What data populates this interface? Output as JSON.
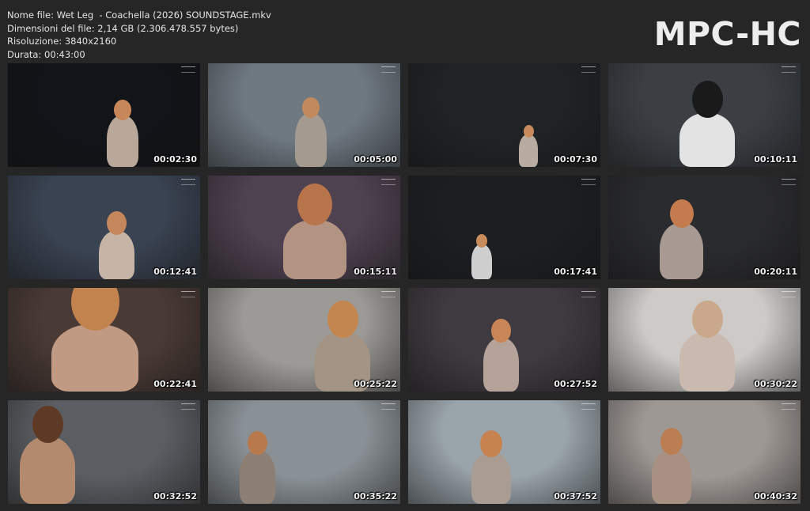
{
  "info": {
    "filename": "Nome file: Wet Leg  - Coachella (2026) SOUNDSTAGE.mkv",
    "filesize": "Dimensioni del file: 2,14 GB (2.306.478.557 bytes)",
    "resolution": "Risoluzione: 3840x2160",
    "duration": "Durata: 00:43:00"
  },
  "logo": "MPC-HC",
  "thumbnails": [
    {
      "time": "00:02:30",
      "bg": "#111418",
      "subject": "#b9a79a",
      "hair": "#c8875a"
    },
    {
      "time": "00:05:00",
      "bg": "#6f7982",
      "subject": "#a59a8f",
      "hair": "#c08a5c"
    },
    {
      "time": "00:07:30",
      "bg": "#202326",
      "subject": "#b8aba0",
      "hair": "#c98a5d"
    },
    {
      "time": "00:10:11",
      "bg": "#3b3f44",
      "subject": "#e3e3e3",
      "hair": "#1a1a1a"
    },
    {
      "time": "00:12:41",
      "bg": "#3a4352",
      "subject": "#c6b5a6",
      "hair": "#c4875b"
    },
    {
      "time": "00:15:11",
      "bg": "#4e4150",
      "subject": "#b39482",
      "hair": "#b8754b"
    },
    {
      "time": "00:17:41",
      "bg": "#1c1f22",
      "subject": "#cfcfcf",
      "hair": "#c78b5c"
    },
    {
      "time": "00:20:11",
      "bg": "#2a2b2e",
      "subject": "#a89a92",
      "hair": "#c47b4e"
    },
    {
      "time": "00:22:41",
      "bg": "#4a3a35",
      "subject": "#c09a83",
      "hair": "#c3834e"
    },
    {
      "time": "00:25:22",
      "bg": "#9c9a96",
      "subject": "#a39485",
      "hair": "#c4864f"
    },
    {
      "time": "00:27:52",
      "bg": "#3f3a40",
      "subject": "#b5a399",
      "hair": "#c98555"
    },
    {
      "time": "00:30:22",
      "bg": "#cdcac8",
      "subject": "#c9b9ae",
      "hair": "#caa88c"
    },
    {
      "time": "00:32:52",
      "bg": "#5a5e62",
      "subject": "#b48a6e",
      "hair": "#5e3a26"
    },
    {
      "time": "00:35:22",
      "bg": "#8a9196",
      "subject": "#8e7f74",
      "hair": "#b87a4c"
    },
    {
      "time": "00:37:52",
      "bg": "#9aa4ab",
      "subject": "#a99c92",
      "hair": "#c7834f"
    },
    {
      "time": "00:40:32",
      "bg": "#9e9894",
      "subject": "#a89082",
      "hair": "#bb7d52"
    }
  ]
}
